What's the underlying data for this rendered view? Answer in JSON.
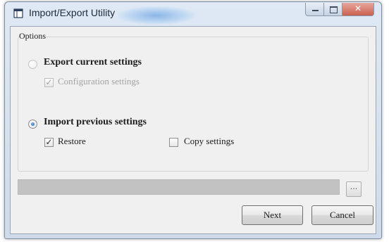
{
  "window": {
    "title": "Import/Export Utility",
    "icon": "document-window-icon",
    "caption_buttons": {
      "minimize_icon": "minimize-icon",
      "maximize_icon": "maximize-icon",
      "close_glyph": "✕"
    }
  },
  "options": {
    "group_label": "Options",
    "export": {
      "label": "Export current settings",
      "selected": false,
      "configuration": {
        "label": "Configuration settings",
        "checked": true,
        "enabled": false,
        "tick": "✓"
      }
    },
    "import": {
      "label": "Import previous settings",
      "selected": true,
      "restore": {
        "label": "Restore",
        "checked": true,
        "tick": "✓"
      },
      "copy_settings": {
        "label": "Copy settings",
        "checked": false
      }
    }
  },
  "path": {
    "value": "",
    "browse_label": "..."
  },
  "buttons": {
    "next": "Next",
    "cancel": "Cancel"
  },
  "colors": {
    "titlebar": "#cfdbea",
    "close_button": "#c9604f",
    "client": "#f0f0f0",
    "progress": "#c2c2c2"
  }
}
